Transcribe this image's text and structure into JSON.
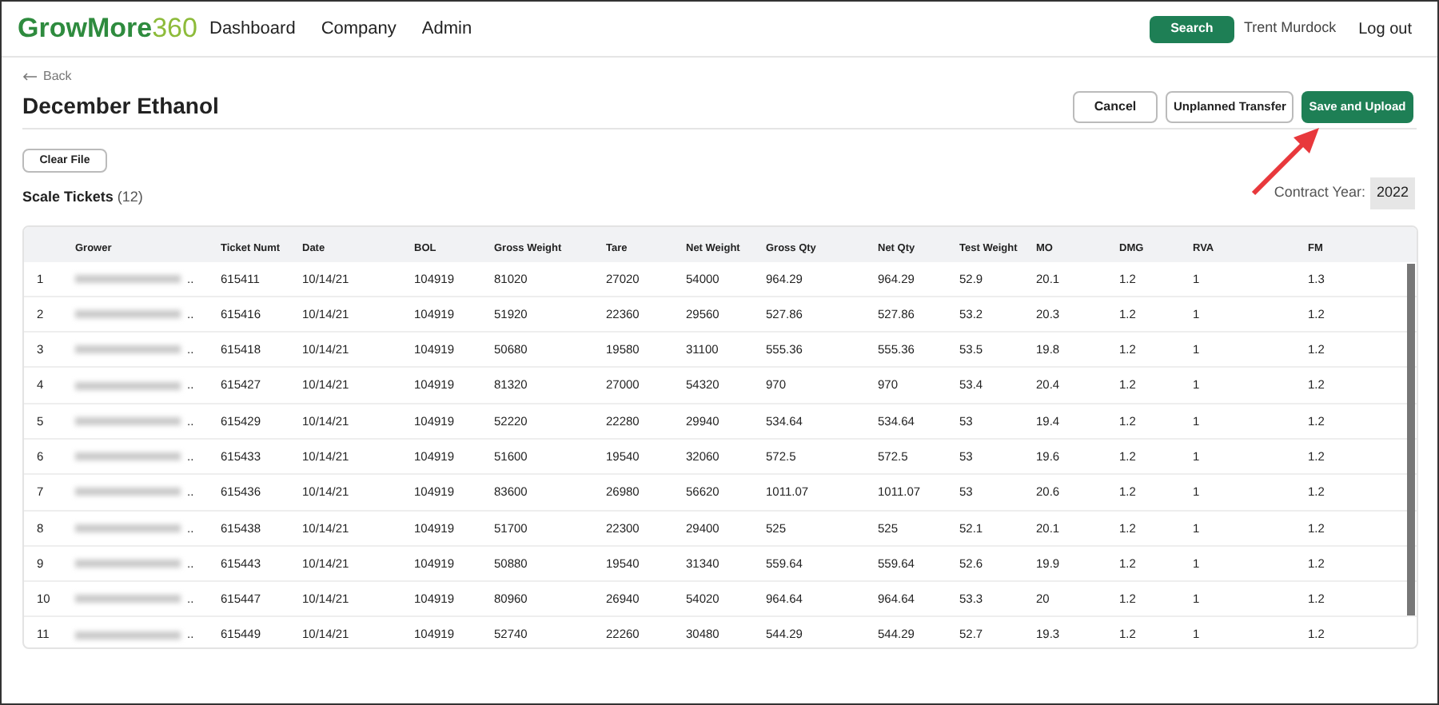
{
  "nav": {
    "logo": "GrowMore",
    "logo_number": "360",
    "links": [
      "Dashboard",
      "Company",
      "Admin"
    ],
    "search_button": "Search",
    "user": "Trent Murdock",
    "logout": "Log out"
  },
  "back": "Back",
  "title": "December Ethanol",
  "actions": [
    "Cancel",
    "Unplanned Transfer",
    "Save and Upload"
  ],
  "clear_button": "Clear File",
  "section": {
    "label": "Scale Tickets",
    "count": "(12)"
  },
  "contract_year": {
    "label": "Contract Year:",
    "value": "2022"
  },
  "table": {
    "columns": [
      "",
      "Grower",
      "Ticket Numt",
      "Date",
      "BOL",
      "Gross Weight",
      "Tare",
      "Net Weight",
      "Gross Qty",
      "Net Qty",
      "Test Weight",
      "MO",
      "DMG",
      "RVA",
      "FM"
    ],
    "rows": [
      [
        "1",
        "..",
        "615411",
        "10/14/21",
        "104919",
        "81020",
        "27020",
        "54000",
        "964.29",
        "964.29",
        "52.9",
        "20.1",
        "1.2",
        "1",
        "1.3"
      ],
      [
        "2",
        "..",
        "615416",
        "10/14/21",
        "104919",
        "51920",
        "22360",
        "29560",
        "527.86",
        "527.86",
        "53.2",
        "20.3",
        "1.2",
        "1",
        "1.2"
      ],
      [
        "3",
        "..",
        "615418",
        "10/14/21",
        "104919",
        "50680",
        "19580",
        "31100",
        "555.36",
        "555.36",
        "53.5",
        "19.8",
        "1.2",
        "1",
        "1.2"
      ],
      [
        "4",
        "..",
        "615427",
        "10/14/21",
        "104919",
        "81320",
        "27000",
        "54320",
        "970",
        "970",
        "53.4",
        "20.4",
        "1.2",
        "1",
        "1.2"
      ],
      [
        "5",
        "..",
        "615429",
        "10/14/21",
        "104919",
        "52220",
        "22280",
        "29940",
        "534.64",
        "534.64",
        "53",
        "19.4",
        "1.2",
        "1",
        "1.2"
      ],
      [
        "6",
        "..",
        "615433",
        "10/14/21",
        "104919",
        "51600",
        "19540",
        "32060",
        "572.5",
        "572.5",
        "53",
        "19.6",
        "1.2",
        "1",
        "1.2"
      ],
      [
        "7",
        "..",
        "615436",
        "10/14/21",
        "104919",
        "83600",
        "26980",
        "56620",
        "1011.07",
        "1011.07",
        "53",
        "20.6",
        "1.2",
        "1",
        "1.2"
      ],
      [
        "8",
        "..",
        "615438",
        "10/14/21",
        "104919",
        "51700",
        "22300",
        "29400",
        "525",
        "525",
        "52.1",
        "20.1",
        "1.2",
        "1",
        "1.2"
      ],
      [
        "9",
        "..",
        "615443",
        "10/14/21",
        "104919",
        "50880",
        "19540",
        "31340",
        "559.64",
        "559.64",
        "52.6",
        "19.9",
        "1.2",
        "1",
        "1.2"
      ],
      [
        "10",
        "..",
        "615447",
        "10/14/21",
        "104919",
        "80960",
        "26940",
        "54020",
        "964.64",
        "964.64",
        "53.3",
        "20",
        "1.2",
        "1",
        "1.2"
      ],
      [
        "11",
        "..",
        "615449",
        "10/14/21",
        "104919",
        "52740",
        "22260",
        "30480",
        "544.29",
        "544.29",
        "52.7",
        "19.3",
        "1.2",
        "1",
        "1.2"
      ]
    ]
  }
}
